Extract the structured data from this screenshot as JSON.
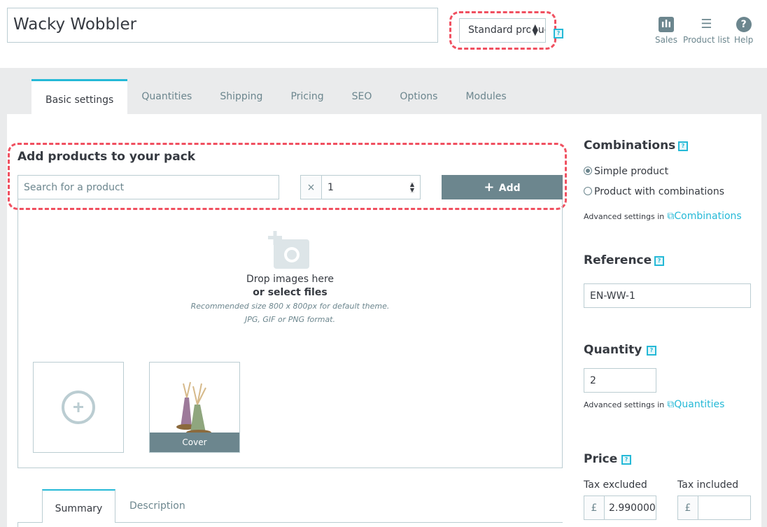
{
  "header": {
    "product_name": "Wacky Wobbler",
    "product_type": "Standard product",
    "help_icon": "question-box-icon",
    "toolbar": [
      {
        "label": "Sales",
        "icon": "bar-chart-icon"
      },
      {
        "label": "Product list",
        "icon": "list-icon"
      },
      {
        "label": "Help",
        "icon": "help-circle-icon"
      }
    ]
  },
  "tabs": [
    "Basic settings",
    "Quantities",
    "Shipping",
    "Pricing",
    "SEO",
    "Options",
    "Modules"
  ],
  "pack": {
    "title": "Add products to your pack",
    "search_placeholder": "Search for a product",
    "qty_prefix": "×",
    "qty_value": "1",
    "add_label": "Add"
  },
  "images": {
    "drop_text": "Drop images here",
    "select_text": "or select files",
    "hint1": "Recommended size 800 x 800px for default theme.",
    "hint2": "JPG, GIF or PNG format.",
    "cover_label": "Cover"
  },
  "desc_tabs": [
    "Summary",
    "Description"
  ],
  "side": {
    "combinations": {
      "title": "Combinations",
      "opt_simple": "Simple product",
      "opt_combo": "Product with combinations",
      "selected": "Simple product",
      "adv": "Advanced settings in",
      "link": "Combinations"
    },
    "reference": {
      "title": "Reference",
      "value": "EN-WW-1"
    },
    "quantity": {
      "title": "Quantity",
      "value": "2",
      "adv": "Advanced settings in",
      "link": "Quantities"
    },
    "price": {
      "title": "Price",
      "tax_excl_label": "Tax excluded",
      "tax_incl_label": "Tax included",
      "currency": "£",
      "tax_excl_value": "2.990000",
      "tax_incl_value": ""
    }
  },
  "colors": {
    "accent": "#25b9d7",
    "button": "#6c868e",
    "highlight": "#f05060"
  }
}
